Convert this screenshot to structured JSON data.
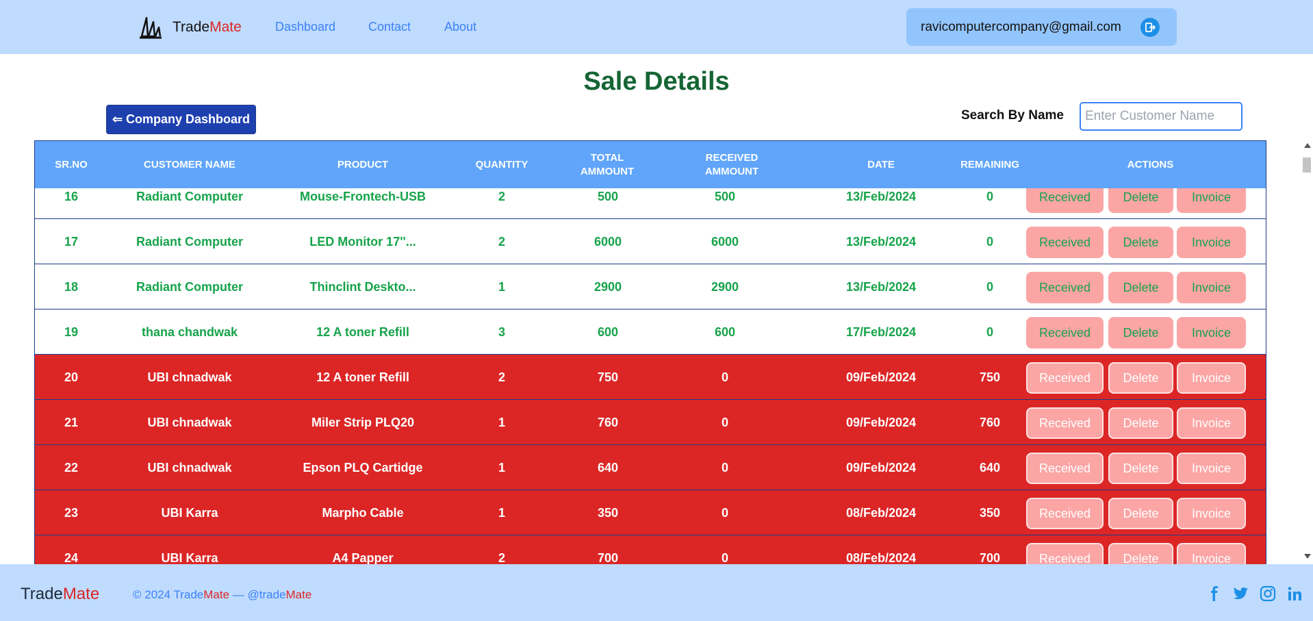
{
  "nav": {
    "brand_trade": "Trade",
    "brand_mate": "Mate",
    "links": [
      "Dashboard",
      "Contact",
      "About"
    ],
    "user_email": "ravicomputercompany@gmail.com"
  },
  "page": {
    "title": "Sale Details",
    "back_button": "⇐ Company Dashboard",
    "search_label": "Search By Name",
    "search_placeholder": "Enter Customer Name"
  },
  "table": {
    "headers": [
      "SR.NO",
      "CUSTOMER NAME",
      "PRODUCT",
      "QUANTITY",
      "TOTAL AMMOUNT",
      "RECEIVED AMMOUNT",
      "DATE",
      "REMAINING",
      "ACTIONS"
    ],
    "action_labels": [
      "Received",
      "Delete",
      "Invoice"
    ],
    "rows": [
      {
        "sr": "16",
        "customer": "Radiant Computer",
        "product": "Mouse-Frontech-USB",
        "qty": "2",
        "total": "500",
        "received": "500",
        "date": "13/Feb/2024",
        "remaining": "0",
        "status": "paid"
      },
      {
        "sr": "17",
        "customer": "Radiant Computer",
        "product": "LED Monitor 17''...",
        "qty": "2",
        "total": "6000",
        "received": "6000",
        "date": "13/Feb/2024",
        "remaining": "0",
        "status": "paid"
      },
      {
        "sr": "18",
        "customer": "Radiant Computer",
        "product": "Thinclint Deskto...",
        "qty": "1",
        "total": "2900",
        "received": "2900",
        "date": "13/Feb/2024",
        "remaining": "0",
        "status": "paid"
      },
      {
        "sr": "19",
        "customer": "thana chandwak",
        "product": "12 A toner Refill",
        "qty": "3",
        "total": "600",
        "received": "600",
        "date": "17/Feb/2024",
        "remaining": "0",
        "status": "paid"
      },
      {
        "sr": "20",
        "customer": "UBI chnadwak",
        "product": "12 A toner Refill",
        "qty": "2",
        "total": "750",
        "received": "0",
        "date": "09/Feb/2024",
        "remaining": "750",
        "status": "unpaid"
      },
      {
        "sr": "21",
        "customer": "UBI chnadwak",
        "product": "Miler Strip PLQ20",
        "qty": "1",
        "total": "760",
        "received": "0",
        "date": "09/Feb/2024",
        "remaining": "760",
        "status": "unpaid"
      },
      {
        "sr": "22",
        "customer": "UBI chnadwak",
        "product": "Epson PLQ Cartidge",
        "qty": "1",
        "total": "640",
        "received": "0",
        "date": "09/Feb/2024",
        "remaining": "640",
        "status": "unpaid"
      },
      {
        "sr": "23",
        "customer": "UBI Karra",
        "product": "Marpho Cable",
        "qty": "1",
        "total": "350",
        "received": "0",
        "date": "08/Feb/2024",
        "remaining": "350",
        "status": "unpaid"
      },
      {
        "sr": "24",
        "customer": "UBI Karra",
        "product": "A4 Papper",
        "qty": "2",
        "total": "700",
        "received": "0",
        "date": "08/Feb/2024",
        "remaining": "700",
        "status": "unpaid"
      }
    ]
  },
  "footer": {
    "brand_trade": "Trade",
    "brand_mate": "Mate",
    "copy_prefix": "© 2024 Trade",
    "copy_mate": "Mate",
    "copy_mid": " — @trade",
    "copy_mate2": "Mate",
    "social_icons": [
      "facebook-icon",
      "twitter-icon",
      "instagram-icon",
      "linkedin-icon"
    ]
  },
  "colors": {
    "nav_bg": "#bfdbfe",
    "header_bg": "#60a5fa",
    "paid_text": "#16a34a",
    "unpaid_row": "#dc2626",
    "action_button": "#fca5a5",
    "title_green": "#166534",
    "brand_red": "#dc2626"
  }
}
